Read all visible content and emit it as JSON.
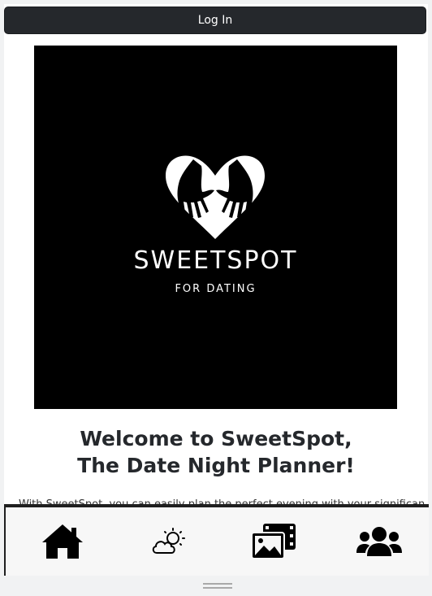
{
  "header": {
    "login_label": "Log In"
  },
  "logo": {
    "brand_name": "SWEETSPOT",
    "brand_tagline": "FOR DATING"
  },
  "welcome": {
    "line1": "Welcome to SweetSpot,",
    "line2": "The Date Night Planner!"
  },
  "intro": {
    "text": "With SweetSpot, you can easily plan the perfect evening with your significant"
  },
  "nav": {
    "items": [
      {
        "name": "home",
        "icon": "home-icon"
      },
      {
        "name": "weather",
        "icon": "cloud-sun-icon"
      },
      {
        "name": "gallery",
        "icon": "photo-film-icon"
      },
      {
        "name": "users",
        "icon": "users-icon"
      }
    ]
  },
  "colors": {
    "button_bg": "#25282c",
    "logo_bg": "#000000",
    "heading": "#25282c"
  }
}
